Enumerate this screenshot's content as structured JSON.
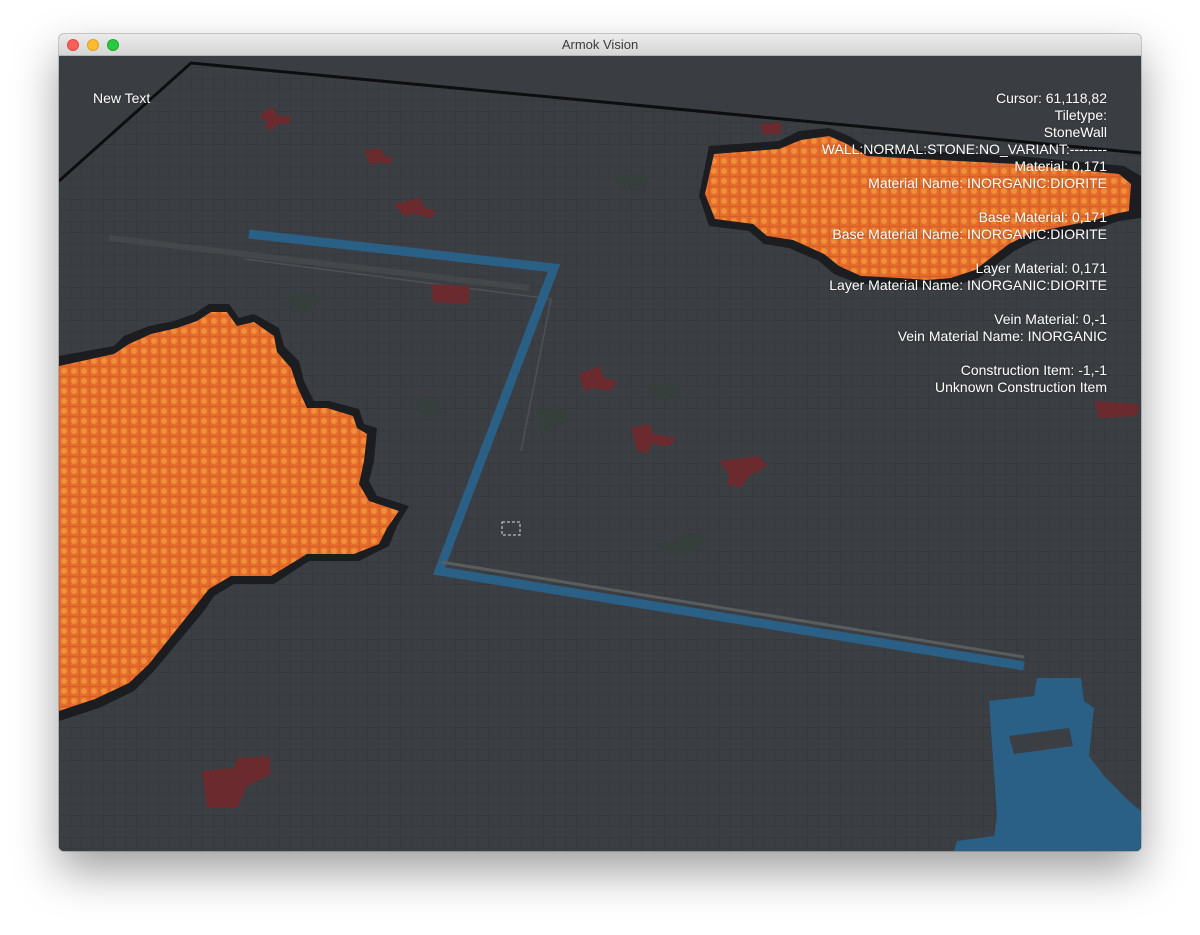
{
  "window": {
    "title": "Armok Vision"
  },
  "hud": {
    "left_text": "New Text",
    "info_lines": [
      "Cursor: 61,118,82",
      "Tiletype:",
      "StoneWall",
      "WALL:NORMAL:STONE:NO_VARIANT:--------",
      "Material: 0,171",
      "Material Name: INORGANIC:DIORITE",
      "",
      "Base Material: 0,171",
      "Base Material Name: INORGANIC:DIORITE",
      "",
      "Layer Material: 0,171",
      "Layer Material Name: INORGANIC:DIORITE",
      "",
      "Vein Material: 0,-1",
      "Vein Material Name: INORGANIC",
      "",
      "Construction Item: -1,-1",
      "Unknown Construction Item"
    ]
  },
  "colors": {
    "stone": "#3b3f43",
    "grid": "#2f3236",
    "magma": "#e8702f",
    "magma_dark": "#1e1f22",
    "water": "#2a5f86",
    "ore_red": "#6a2a2e",
    "ore_green": "#36403c"
  },
  "icons": {
    "close": "close-icon",
    "minimize": "minimize-icon",
    "zoom": "zoom-icon"
  }
}
